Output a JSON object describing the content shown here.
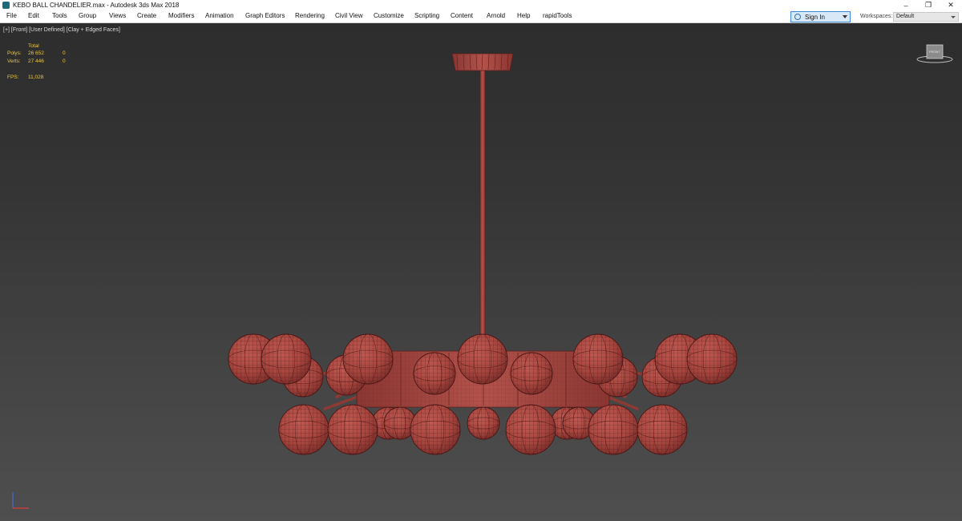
{
  "window": {
    "title": "KEBO BALL CHANDELIER.max - Autodesk 3ds Max 2018",
    "buttons": {
      "minimize": "–",
      "restore": "❐",
      "close": "✕"
    }
  },
  "menu": {
    "items": [
      "File",
      "Edit",
      "Tools",
      "Group",
      "Views",
      "Create",
      "Modifiers",
      "Animation",
      "Graph Editors",
      "Rendering",
      "Civil View",
      "Customize",
      "Scripting",
      "Content",
      "Arnold",
      "Help",
      "rapidTools"
    ],
    "sign_in": "Sign In",
    "workspaces_label": "Workspaces:",
    "workspace_value": "Default"
  },
  "viewport": {
    "label": "[+] [Front] [User Defined] [Clay + Edged Faces]",
    "stats": {
      "header": "Total",
      "polys_label": "Polys:",
      "polys_value": "26 652",
      "polys_sel": "0",
      "verts_label": "Verts:",
      "verts_value": "27 446",
      "verts_sel": "0",
      "fps_label": "FPS:",
      "fps_value": "11,028"
    },
    "viewcube_face": "FRONT",
    "model_color": "#a7463f"
  }
}
